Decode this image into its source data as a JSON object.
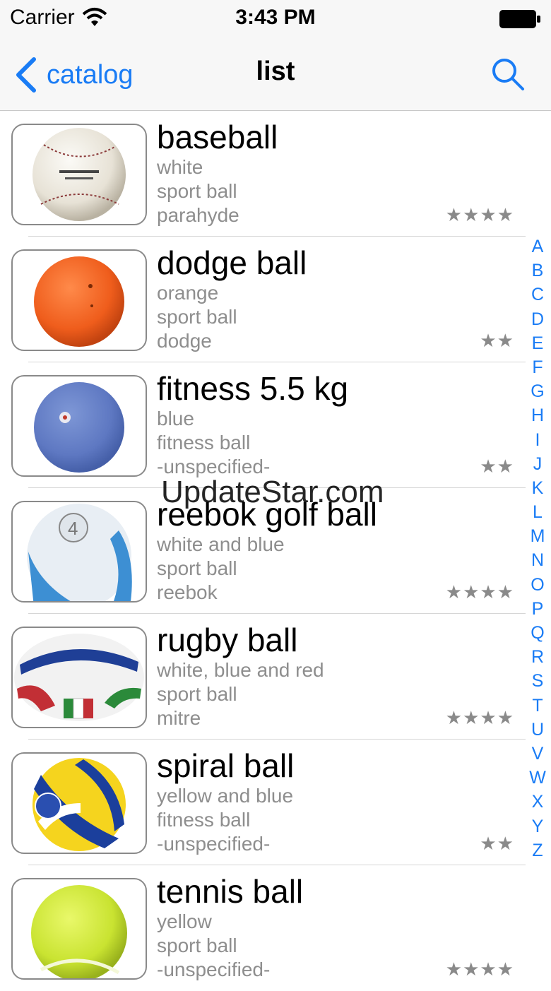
{
  "status_bar": {
    "carrier": "Carrier",
    "time": "3:43 PM"
  },
  "nav": {
    "back_label": "catalog",
    "title": "list"
  },
  "items": [
    {
      "name": "baseball",
      "color": "white",
      "category": "sport ball",
      "brand": "parahyde",
      "stars": "★★★★",
      "image": "baseball-image"
    },
    {
      "name": "dodge ball",
      "color": "orange",
      "category": "sport ball",
      "brand": "dodge",
      "stars": "★★",
      "image": "dodge-ball-image"
    },
    {
      "name": "fitness 5.5 kg",
      "color": "blue",
      "category": "fitness ball",
      "brand": "-unspecified-",
      "stars": "★★",
      "image": "fitness-ball-image"
    },
    {
      "name": "reebok golf ball",
      "color": "white and blue",
      "category": "sport ball",
      "brand": "reebok",
      "stars": "★★★★",
      "image": "reebok-ball-image"
    },
    {
      "name": "rugby ball",
      "color": "white, blue and red",
      "category": "sport ball",
      "brand": "mitre",
      "stars": "★★★★",
      "image": "rugby-ball-image"
    },
    {
      "name": "spiral ball",
      "color": "yellow and blue",
      "category": "fitness ball",
      "brand": "-unspecified-",
      "stars": "★★",
      "image": "spiral-ball-image"
    },
    {
      "name": "tennis ball",
      "color": "yellow",
      "category": "sport ball",
      "brand": "-unspecified-",
      "stars": "★★★★",
      "image": "tennis-ball-image"
    }
  ],
  "index_letters": [
    "A",
    "B",
    "C",
    "D",
    "E",
    "F",
    "G",
    "H",
    "I",
    "J",
    "K",
    "L",
    "M",
    "N",
    "O",
    "P",
    "Q",
    "R",
    "S",
    "T",
    "U",
    "V",
    "W",
    "X",
    "Y",
    "Z"
  ],
  "watermark": "UpdateStar.com",
  "colors": {
    "accent": "#1a7cf5",
    "secondary_text": "#8e8e8e"
  }
}
